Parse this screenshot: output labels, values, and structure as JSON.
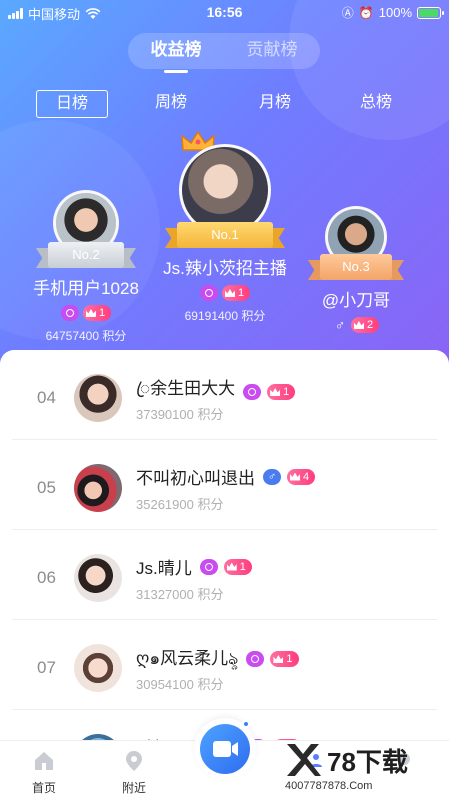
{
  "status_bar": {
    "carrier": "中国移动",
    "time": "16:56",
    "battery": "100%",
    "battery_level": 1.0
  },
  "top_tabs": [
    {
      "label": "收益榜",
      "active": true
    },
    {
      "label": "贡献榜",
      "active": false
    }
  ],
  "period_tabs": [
    {
      "label": "日榜",
      "active": true
    },
    {
      "label": "周榜",
      "active": false
    },
    {
      "label": "月榜",
      "active": false
    },
    {
      "label": "总榜",
      "active": false
    }
  ],
  "podium": {
    "first": {
      "rank_label": "No.1",
      "name": "Js.辣小茨招主播",
      "level": "1",
      "points": "69191400 积分"
    },
    "second": {
      "rank_label": "No.2",
      "name": "手机用户1028",
      "level": "1",
      "points": "64757400 积分"
    },
    "third": {
      "rank_label": "No.3",
      "name": "@小刀哥",
      "level": "2",
      "points": ""
    }
  },
  "list": [
    {
      "rank": "04",
      "name": "ꦿ余生田大大",
      "badge": "search",
      "level": "1",
      "points": "37390100 积分"
    },
    {
      "rank": "05",
      "name": "不叫初心叫退出",
      "badge": "male",
      "level": "4",
      "points": "35261900 积分"
    },
    {
      "rank": "06",
      "name": "Js.晴儿",
      "badge": "search",
      "level": "1",
      "points": "31327000 积分"
    },
    {
      "rank": "07",
      "name": "ღ๑风云柔儿ৡ",
      "badge": "search",
      "level": "1",
      "points": "30954100 积分"
    },
    {
      "rank": "",
      "name": "手机用",
      "badge": "search",
      "level": "1",
      "points": ""
    }
  ],
  "bottom_nav": {
    "home": "首页",
    "nearby": "附近"
  },
  "watermark": {
    "brand": "78下载",
    "phone": "4007787878.Com"
  },
  "colors": {
    "accent": "#5a7dff",
    "crown_badge": "#ff4f88",
    "search_badge": "#c94cf0",
    "male_badge": "#4a7cf0"
  }
}
